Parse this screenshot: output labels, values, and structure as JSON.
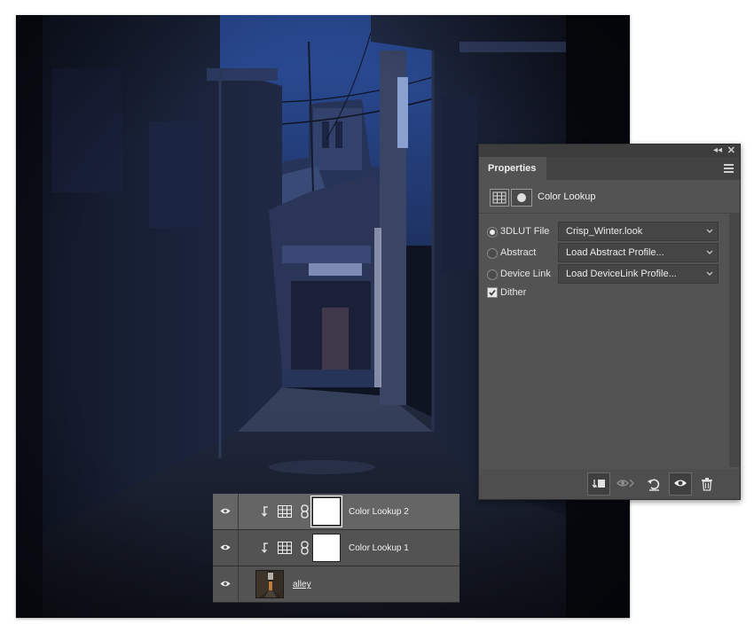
{
  "canvas": {
    "photo": "dark-blue-alley-photo"
  },
  "properties_panel": {
    "tab_label": "Properties",
    "title": "Color Lookup",
    "options": [
      {
        "label": "3DLUT File",
        "selected": true,
        "value": "Crisp_Winter.look"
      },
      {
        "label": "Abstract",
        "selected": false,
        "value": "Load Abstract Profile..."
      },
      {
        "label": "Device Link",
        "selected": false,
        "value": "Load DeviceLink Profile..."
      }
    ],
    "dither": {
      "label": "Dither",
      "checked": true
    },
    "footer_icons": [
      "clip-to-layer-icon",
      "view-previous-state-icon",
      "reset-icon",
      "visibility-icon",
      "trash-icon"
    ]
  },
  "layers_panel": {
    "layers": [
      {
        "name": "Color Lookup 2",
        "type": "adjustment",
        "clipped": true,
        "selected": true
      },
      {
        "name": "Color Lookup 1",
        "type": "adjustment",
        "clipped": true,
        "selected": false
      },
      {
        "name": "alley",
        "type": "image",
        "clipped": false,
        "selected": false
      }
    ]
  },
  "colors": {
    "panel_bg": "#535353",
    "photo_sky": "#2f4f9a",
    "photo_shadow": "#0f1423"
  }
}
